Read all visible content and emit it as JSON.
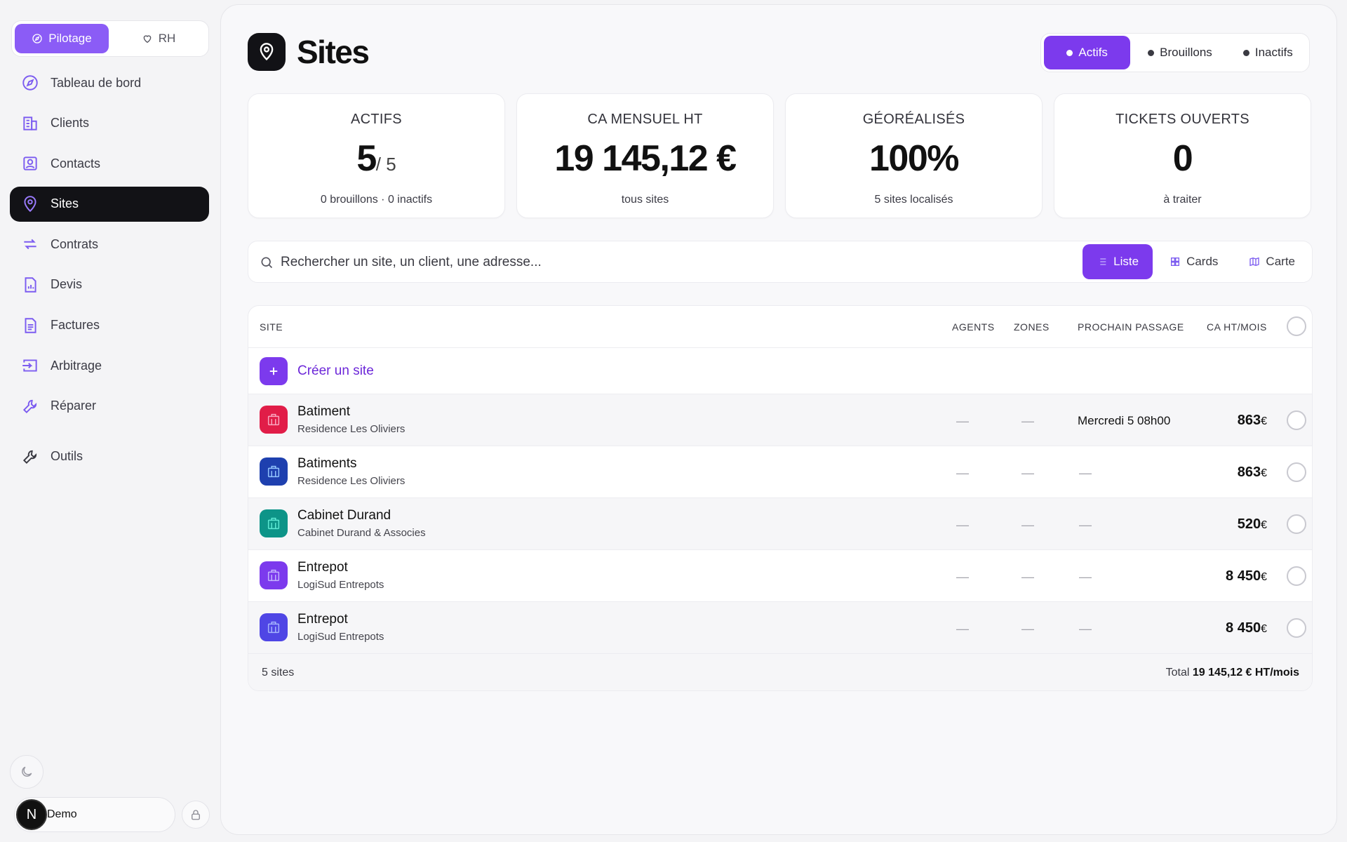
{
  "sidebar": {
    "modes": [
      {
        "label": "Pilotage",
        "icon": "compass-icon",
        "active": true
      },
      {
        "label": "RH",
        "icon": "heart-icon",
        "active": false
      }
    ],
    "items": [
      {
        "label": "Tableau de bord",
        "icon": "compass-icon"
      },
      {
        "label": "Clients",
        "icon": "building-icon"
      },
      {
        "label": "Contacts",
        "icon": "contact-card-icon"
      },
      {
        "label": "Sites",
        "icon": "map-pin-icon",
        "active": true
      },
      {
        "label": "Contrats",
        "icon": "repeat-icon"
      },
      {
        "label": "Devis",
        "icon": "chart-document-icon"
      },
      {
        "label": "Factures",
        "icon": "document-icon"
      },
      {
        "label": "Arbitrage",
        "icon": "arrow-into-box-icon"
      },
      {
        "label": "Réparer",
        "icon": "wrench-icon"
      },
      {
        "label": "Outils",
        "icon": "wrench-icon"
      }
    ],
    "user": {
      "initial": "N",
      "name": "Demo"
    }
  },
  "header": {
    "title": "Sites",
    "status_tabs": [
      {
        "label": "Actifs",
        "active": true
      },
      {
        "label": "Brouillons",
        "active": false
      },
      {
        "label": "Inactifs",
        "active": false
      }
    ]
  },
  "kpis": [
    {
      "label": "ACTIFS",
      "value": "5",
      "sub": "/ 5",
      "foot": "0 brouillons · 0 inactifs"
    },
    {
      "label": "CA MENSUEL HT",
      "value": "19 145,12 €",
      "sub": "",
      "foot": "tous sites"
    },
    {
      "label": "GÉORÉALISÉS",
      "value": "100%",
      "sub": "",
      "foot": "5 sites localisés"
    },
    {
      "label": "TICKETS OUVERTS",
      "value": "0",
      "sub": "",
      "foot": "à traiter"
    }
  ],
  "search": {
    "placeholder": "Rechercher un site, un client, une adresse..."
  },
  "view_tabs": [
    {
      "label": "Liste",
      "icon": "list-icon",
      "active": true
    },
    {
      "label": "Cards",
      "icon": "grid-icon",
      "active": false
    },
    {
      "label": "Carte",
      "icon": "map-icon",
      "active": false
    }
  ],
  "table": {
    "headers": {
      "site": "SITE",
      "agents": "AGENTS",
      "zones": "ZONES",
      "next": "PROCHAIN PASSAGE",
      "ca": "CA HT/MOIS"
    },
    "create_label": "Créer un site",
    "rows": [
      {
        "name": "Batiment",
        "client": "Residence Les Oliviers",
        "agents": "—",
        "zones": "—",
        "next": "Mercredi 5 08h00",
        "ca": "863",
        "currency": "€",
        "color": "#e11d48"
      },
      {
        "name": "Batiments",
        "client": "Residence Les Oliviers",
        "agents": "—",
        "zones": "—",
        "next": "—",
        "ca": "863",
        "currency": "€",
        "color": "#1e40af"
      },
      {
        "name": "Cabinet Durand",
        "client": "Cabinet Durand & Associes",
        "agents": "—",
        "zones": "—",
        "next": "—",
        "ca": "520",
        "currency": "€",
        "color": "#0d9488"
      },
      {
        "name": "Entrepot",
        "client": "LogiSud Entrepots",
        "agents": "—",
        "zones": "—",
        "next": "—",
        "ca": "8 450",
        "currency": "€",
        "color": "#7c3aed"
      },
      {
        "name": "Entrepot",
        "client": "LogiSud Entrepots",
        "agents": "—",
        "zones": "—",
        "next": "—",
        "ca": "8 450",
        "currency": "€",
        "color": "#4f46e5"
      }
    ],
    "footer": {
      "count": "5 sites",
      "total_prefix": "Total",
      "total_value": "19 145,12 € HT/mois"
    }
  },
  "colors": {
    "accent": "#7c3aed",
    "active_nav": "#121216"
  }
}
